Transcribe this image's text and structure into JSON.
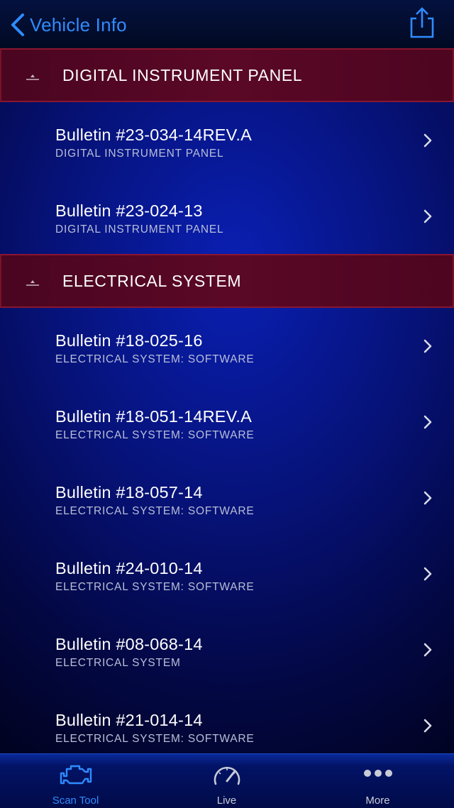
{
  "navbar": {
    "back_label": "Vehicle Info",
    "share_icon": "share-icon"
  },
  "sections": [
    {
      "title": "DIGITAL INSTRUMENT PANEL",
      "items": [
        {
          "title": "Bulletin #23-034-14REV.A",
          "subtitle": "DIGITAL INSTRUMENT PANEL"
        },
        {
          "title": "Bulletin #23-024-13",
          "subtitle": "DIGITAL INSTRUMENT PANEL"
        }
      ]
    },
    {
      "title": "ELECTRICAL SYSTEM",
      "items": [
        {
          "title": "Bulletin #18-025-16",
          "subtitle": "ELECTRICAL SYSTEM: SOFTWARE"
        },
        {
          "title": "Bulletin #18-051-14REV.A",
          "subtitle": "ELECTRICAL SYSTEM: SOFTWARE"
        },
        {
          "title": "Bulletin #18-057-14",
          "subtitle": "ELECTRICAL SYSTEM: SOFTWARE"
        },
        {
          "title": "Bulletin #24-010-14",
          "subtitle": "ELECTRICAL SYSTEM: SOFTWARE"
        },
        {
          "title": "Bulletin #08-068-14",
          "subtitle": "ELECTRICAL SYSTEM"
        },
        {
          "title": "Bulletin #21-014-14",
          "subtitle": "ELECTRICAL SYSTEM: SOFTWARE"
        }
      ]
    }
  ],
  "tabbar": {
    "tabs": [
      {
        "label": "Scan Tool",
        "icon": "engine-icon",
        "active": true
      },
      {
        "label": "Live",
        "icon": "speedometer-icon",
        "active": false
      },
      {
        "label": "More",
        "icon": "more-dots-icon",
        "active": false
      }
    ]
  },
  "colors": {
    "accent": "#2f8cff",
    "section_bg": "#5a0826",
    "tab_inactive": "#c9ccd6"
  }
}
